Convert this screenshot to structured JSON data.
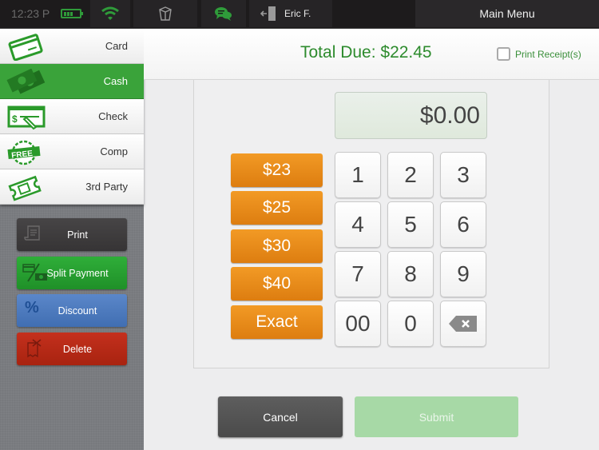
{
  "status_bar": {
    "time": "12:23 P",
    "battery_icon": "battery-icon",
    "wifi_icon": "wifi-icon",
    "box_icon": "takeout-box-icon",
    "chat_icon": "chat-icon",
    "user_icon": "logout-door-icon",
    "user_name": "Eric F.",
    "main_menu_label": "Main Menu"
  },
  "payment_types": [
    {
      "label": "Card",
      "icon": "credit-card-icon",
      "active": false
    },
    {
      "label": "Cash",
      "icon": "cash-icon",
      "active": true
    },
    {
      "label": "Check",
      "icon": "check-icon",
      "active": false
    },
    {
      "label": "Comp",
      "icon": "free-badge-icon",
      "active": false
    },
    {
      "label": "3rd Party",
      "icon": "ticket-icon",
      "active": false
    }
  ],
  "actions": {
    "print": "Print",
    "split_payment": "Split Payment",
    "discount": "Discount",
    "delete": "Delete"
  },
  "header": {
    "total_due": "Total Due: $22.45",
    "print_receipt_label": "Print Receipt(s)",
    "print_receipt_checked": false
  },
  "amount_display": "$0.00",
  "quick_amounts": [
    "$23",
    "$25",
    "$30",
    "$40",
    "Exact"
  ],
  "keypad": [
    "1",
    "2",
    "3",
    "4",
    "5",
    "6",
    "7",
    "8",
    "9",
    "00",
    "0"
  ],
  "buttons": {
    "cancel": "Cancel",
    "submit": "Submit"
  },
  "colors": {
    "accent_green": "#3aa33a",
    "total_green": "#2d8b2d",
    "quick_orange": "#e88a1a",
    "split_green": "#27a032",
    "discount_blue": "#4d7bbf",
    "delete_red": "#b82a16",
    "submit_disabled": "#a7d9a6"
  }
}
